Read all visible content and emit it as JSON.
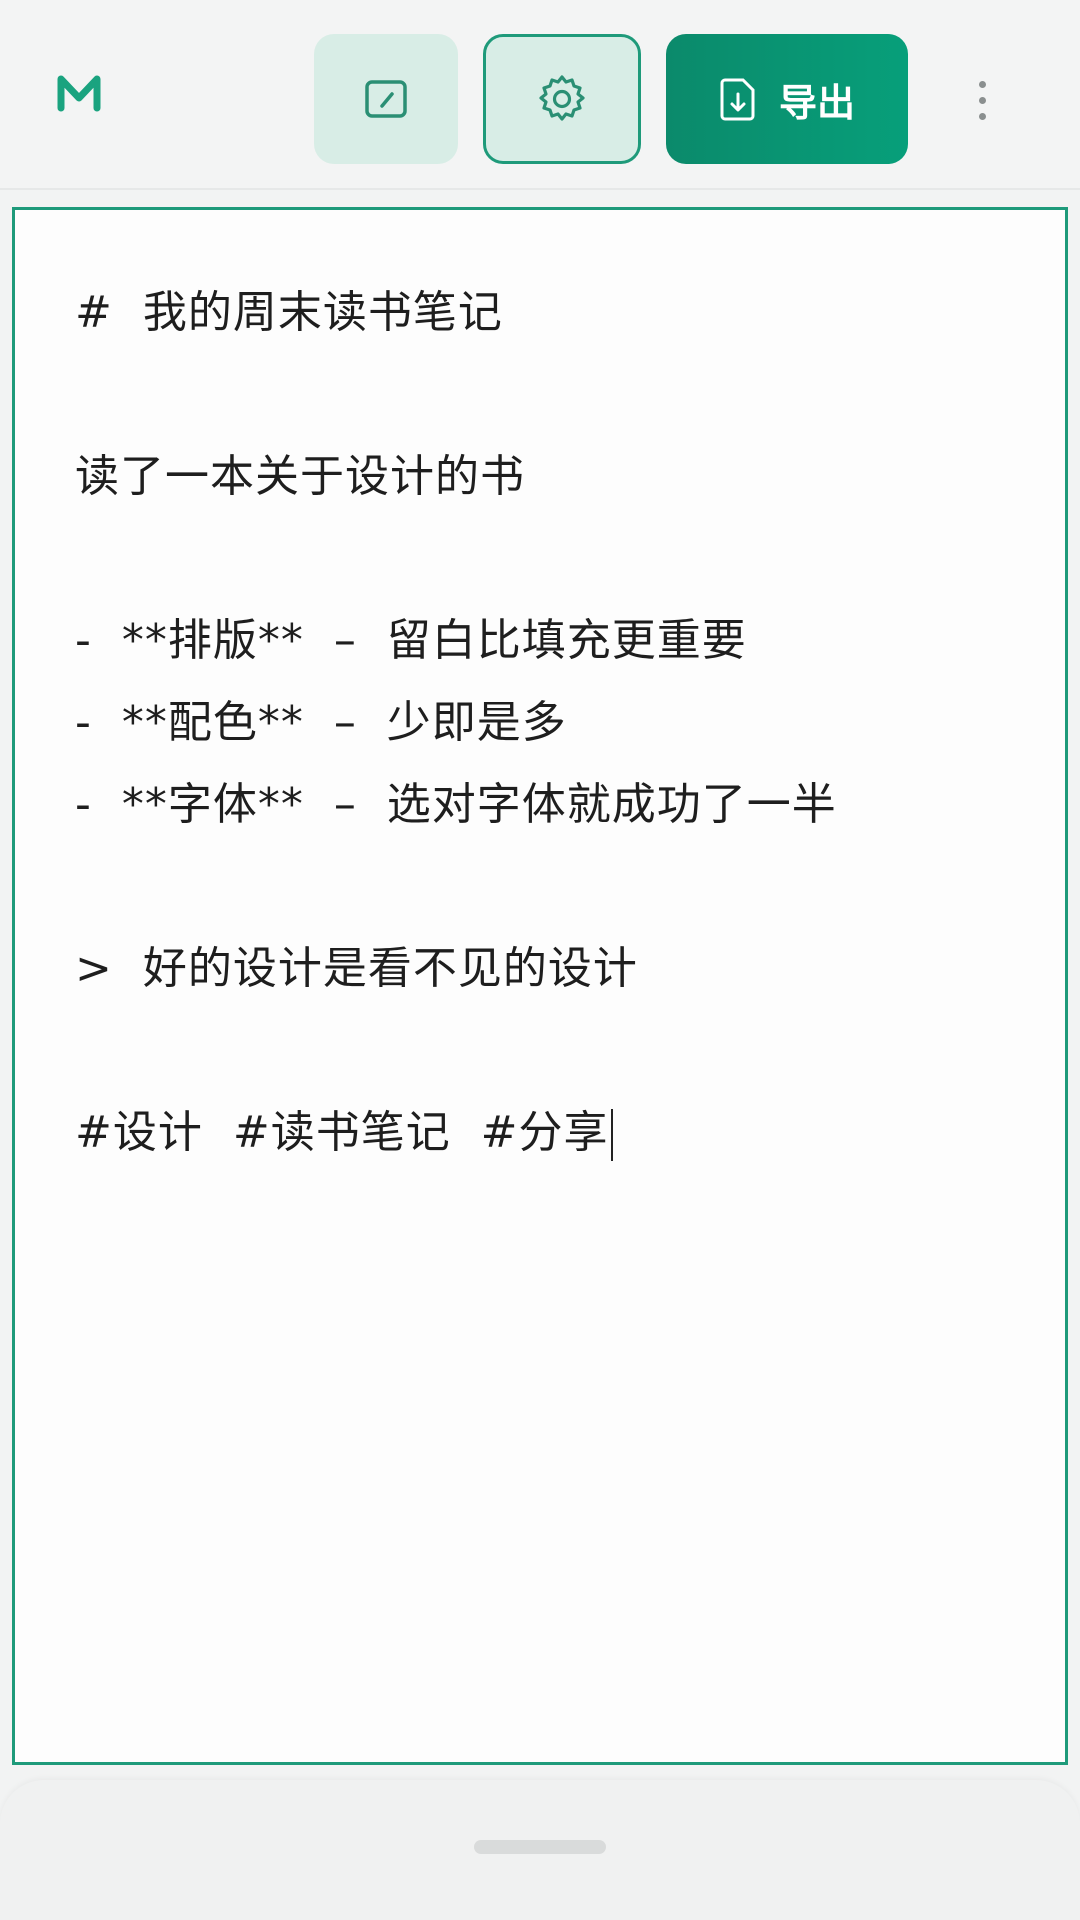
{
  "toolbar": {
    "logo_icon": "markdown-m-logo",
    "preview_icon": "edit-square-icon",
    "settings_icon": "gear-icon",
    "export_icon": "file-download-icon",
    "export_label": "导出",
    "more_icon": "more-vertical-icon",
    "accent_color": "#079f7a",
    "accent_light": "#d8ede6"
  },
  "editor": {
    "lines": [
      "#  我的周末读书笔记",
      "",
      "读了一本关于设计的书",
      "",
      "-  **排版**  –  留白比填充更重要",
      "-  **配色**  –  少即是多",
      "-  **字体**  –  选对字体就成功了一半",
      "",
      ">  好的设计是看不见的设计",
      "",
      "#设计  #读书笔记  #分享"
    ]
  }
}
